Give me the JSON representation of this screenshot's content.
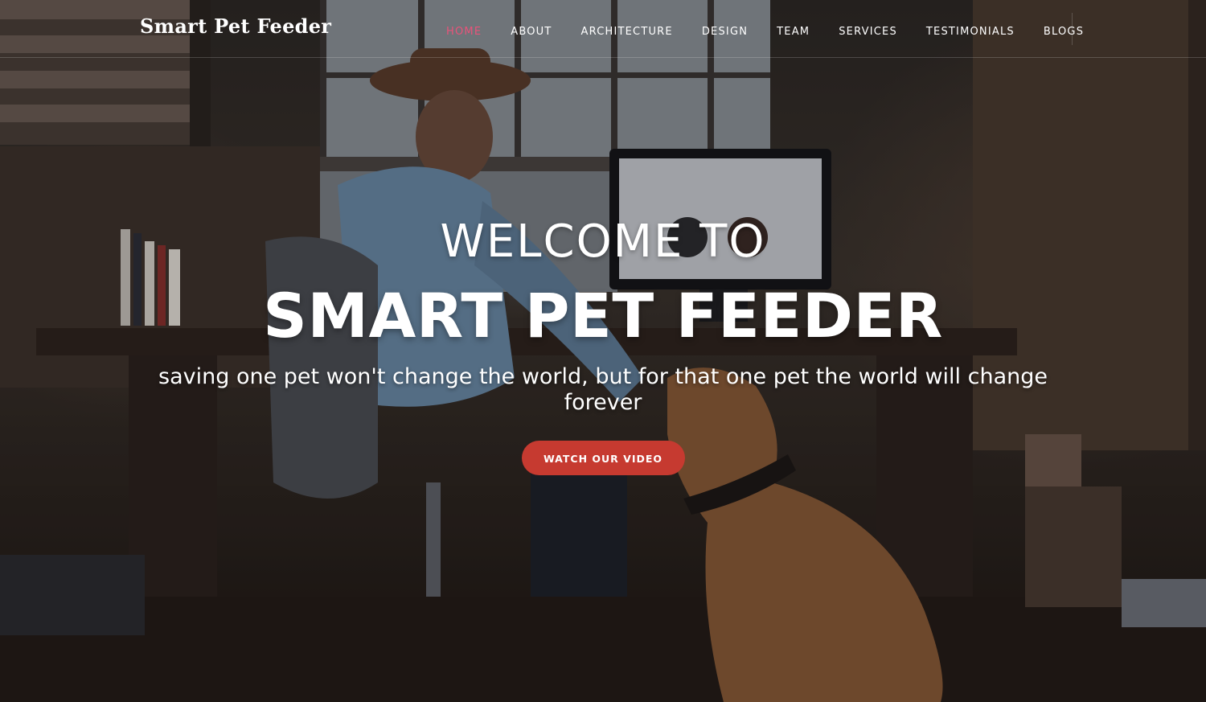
{
  "header": {
    "brand": "Smart Pet Feeder",
    "nav": [
      {
        "label": "HOME",
        "active": true
      },
      {
        "label": "ABOUT",
        "active": false
      },
      {
        "label": "ARCHITECTURE",
        "active": false
      },
      {
        "label": "DESIGN",
        "active": false
      },
      {
        "label": "TEAM",
        "active": false
      },
      {
        "label": "SERVICES",
        "active": false
      },
      {
        "label": "TESTIMONIALS",
        "active": false
      },
      {
        "label": "BLOGS",
        "active": false
      }
    ]
  },
  "hero": {
    "kicker": "WELCOME TO",
    "title": "SMART PET FEEDER",
    "subtitle": "saving one pet won't change the world, but for that one pet the world will change forever",
    "cta_label": "WATCH OUR VIDEO"
  },
  "colors": {
    "nav_active": "#e8537a",
    "cta_background": "#c63a30",
    "text": "#ffffff"
  }
}
